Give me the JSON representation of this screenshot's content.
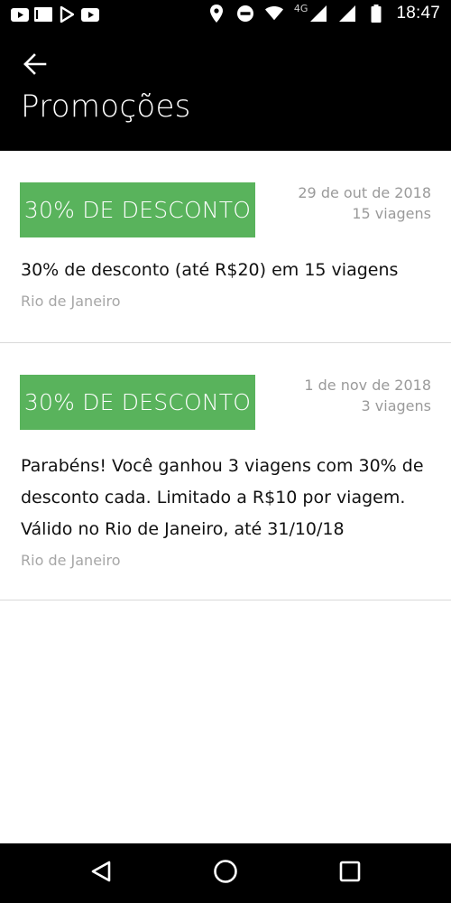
{
  "status_bar": {
    "time": "18:47",
    "network_label": "4G",
    "left_icons": [
      "youtube-icon",
      "mail-icon",
      "play-store-icon",
      "youtube-icon"
    ],
    "right_icons": [
      "location-icon",
      "do-not-disturb-icon",
      "wifi-icon",
      "signal-icon",
      "signal-icon",
      "battery-icon"
    ]
  },
  "app_bar": {
    "title": "Promoções",
    "back_icon": "arrow-left-icon"
  },
  "promos": [
    {
      "badge": "30% DE DESCONTO",
      "date": "29 de out de 2018",
      "trips": "15 viagens",
      "description": "30% de desconto (até R$20) em 15 viagens",
      "city": "Rio de Janeiro"
    },
    {
      "badge": "30% DE DESCONTO",
      "date": "1 de nov de 2018",
      "trips": "3 viagens",
      "description": "Parabéns! Você ganhou 3 viagens com 30% de desconto cada. Limitado a R$10 por viagem. Válido no Rio de Janeiro, até 31/10/18",
      "city": "Rio de Janeiro"
    }
  ],
  "colors": {
    "badge_green": "#59b35c",
    "bar_black": "#000000",
    "meta_gray": "#9a9a9a",
    "divider": "#d9d9d9"
  },
  "nav_bar": {
    "icons": [
      "back-triangle-icon",
      "home-circle-icon",
      "recents-square-icon"
    ]
  }
}
